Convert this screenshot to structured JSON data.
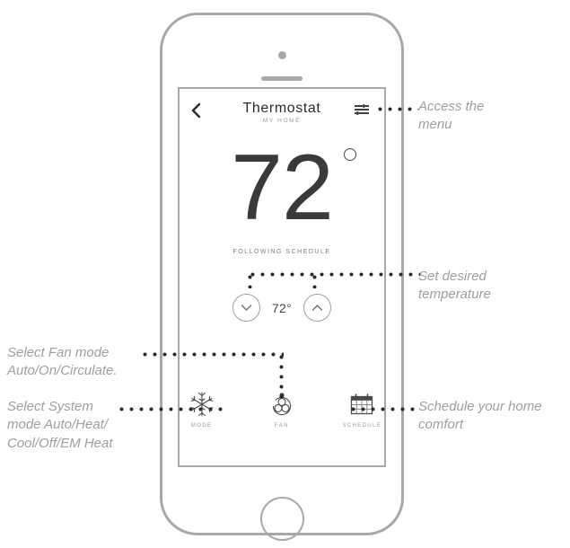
{
  "device": {
    "frame_name": "iphone-outline",
    "camera_icon": "camera-dot",
    "speaker_icon": "speaker-grille",
    "home_button_icon": "home-button"
  },
  "app": {
    "header": {
      "back_icon": "back-chevron-icon",
      "title": "Thermostat",
      "subtitle": "MY HOME",
      "menu_icon": "settings-sliders-icon"
    },
    "temperature": {
      "current_value": "72",
      "degree_symbol": "°",
      "status": "FOLLOWING SCHEDULE"
    },
    "setpoint": {
      "decrease_icon": "chevron-down-icon",
      "value": "72°",
      "increase_icon": "chevron-up-icon"
    },
    "nav": [
      {
        "label": "MODE",
        "icon": "snowflake-icon"
      },
      {
        "label": "FAN",
        "icon": "fan-icon"
      },
      {
        "label": "SCHEDULE",
        "icon": "calendar-icon"
      }
    ]
  },
  "annotations": {
    "menu": "Access the\nmenu",
    "setpoint": "Set desired\ntemperature",
    "schedule": "Schedule your home\ncomfort",
    "fan": "Select Fan mode\nAuto/On/Circulate.",
    "system": "Select System\nmode Auto/Heat/\nCool/Off/EM Heat"
  },
  "colors": {
    "frame": "#a8a8a8",
    "text_dark": "#2b2b2b",
    "text_muted": "#9a9a9a",
    "annotation": "#9e9e9e",
    "dot": "#2b2b2b"
  }
}
